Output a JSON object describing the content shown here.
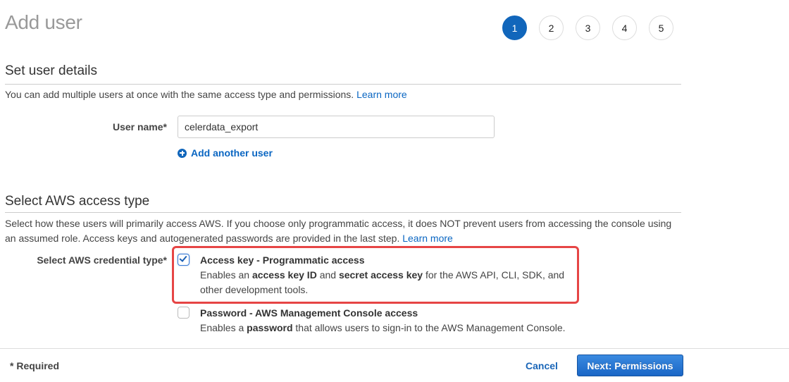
{
  "page": {
    "title": "Add user"
  },
  "steps": [
    {
      "label": "1",
      "active": true
    },
    {
      "label": "2",
      "active": false
    },
    {
      "label": "3",
      "active": false
    },
    {
      "label": "4",
      "active": false
    },
    {
      "label": "5",
      "active": false
    }
  ],
  "user_details": {
    "heading": "Set user details",
    "description": "You can add multiple users at once with the same access type and permissions.",
    "learn_more": "Learn more",
    "user_name_label": "User name*",
    "user_name_value": "celerdata_export",
    "add_another_user": "Add another user"
  },
  "access_type": {
    "heading": "Select AWS access type",
    "description": "Select how these users will primarily access AWS. If you choose only programmatic access, it does NOT prevent users from accessing the console using an assumed role. Access keys and autogenerated passwords are provided in the last step.",
    "learn_more": "Learn more",
    "credential_label": "Select AWS credential type*",
    "options": [
      {
        "title": "Access key - Programmatic access",
        "checked": true,
        "desc_parts": [
          "Enables an ",
          "access key ID",
          " and ",
          "secret access key",
          " for the AWS API, CLI, SDK, and other development tools."
        ]
      },
      {
        "title": "Password - AWS Management Console access",
        "checked": false,
        "desc_parts": [
          "Enables a ",
          "password",
          " that allows users to sign-in to the AWS Management Console."
        ]
      }
    ]
  },
  "footer": {
    "required_note": "* Required",
    "cancel_label": "Cancel",
    "next_label": "Next: Permissions"
  },
  "colors": {
    "accent": "#1166bb",
    "highlight": "#e64545",
    "link": "#0a66c2"
  }
}
